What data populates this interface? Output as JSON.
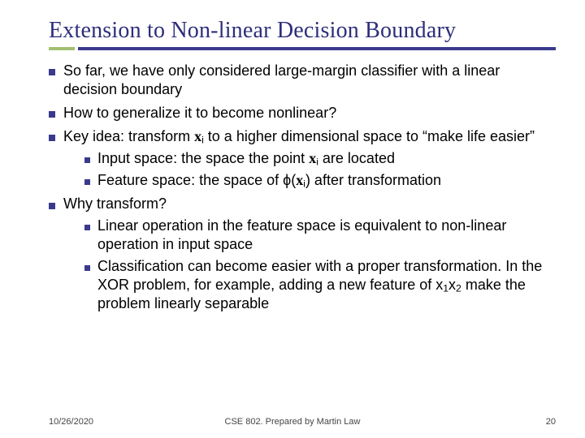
{
  "title": "Extension to Non-linear Decision Boundary",
  "bullets": {
    "b1_pre": "So far, we have only considered large-margin classifier with a linear decision boundary",
    "b2": "How to generalize it to become nonlinear?",
    "b3_a": "Key idea: transform ",
    "b3_var": "x",
    "b3_sub": "i",
    "b3_b": " to a higher dimensional space to “make life easier”",
    "b3_1_a": "Input space: the space the point ",
    "b3_1_var": "x",
    "b3_1_sub": "i",
    "b3_1_b": " are located",
    "b3_2_a": "Feature space: the space of ϕ(",
    "b3_2_var": "x",
    "b3_2_sub": "i",
    "b3_2_b": ") after transformation",
    "b4": "Why transform?",
    "b4_1": "Linear operation in the feature space is equivalent to non-linear operation in input space",
    "b4_2_a": "Classification can become easier with a proper transformation. In the XOR problem, for example, adding a new feature of x",
    "b4_2_s1": "1",
    "b4_2_mid": "x",
    "b4_2_s2": "2",
    "b4_2_b": " make the problem linearly separable"
  },
  "footer": {
    "date": "10/26/2020",
    "center": "CSE 802. Prepared by Martin Law",
    "page": "20"
  }
}
